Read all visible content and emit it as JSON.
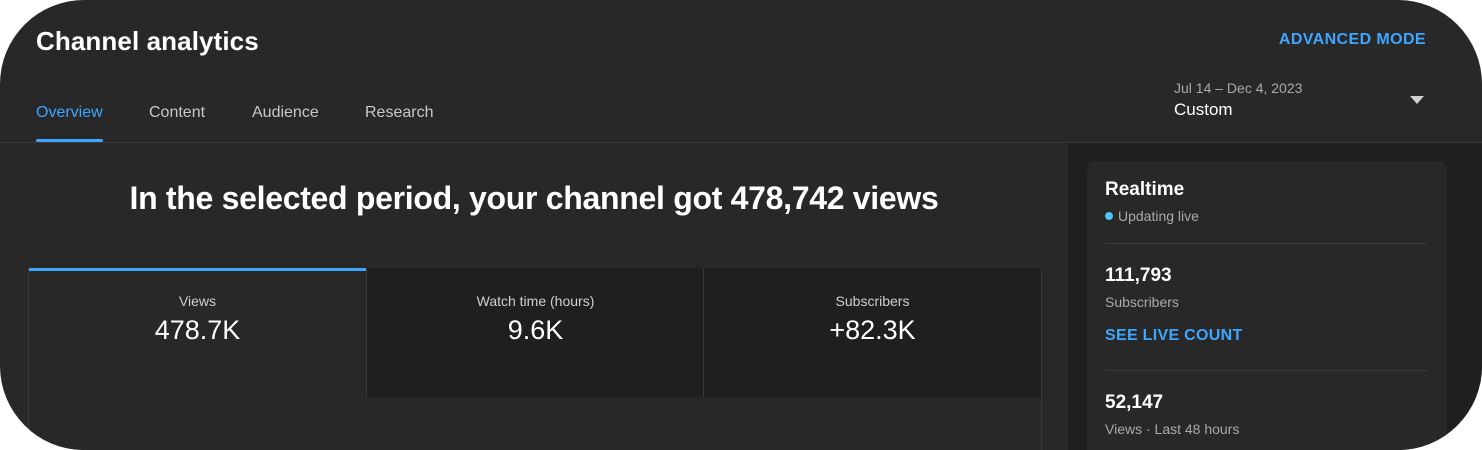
{
  "header": {
    "title": "Channel analytics",
    "advanced_mode_label": "ADVANCED MODE"
  },
  "tabs": [
    {
      "label": "Overview",
      "active": true
    },
    {
      "label": "Content",
      "active": false
    },
    {
      "label": "Audience",
      "active": false
    },
    {
      "label": "Research",
      "active": false
    }
  ],
  "date_picker": {
    "range": "Jul 14 – Dec 4, 2023",
    "preset": "Custom",
    "icon": "chevron-down-icon"
  },
  "summary": {
    "headline": "In the selected period, your channel got 478,742 views"
  },
  "metrics": [
    {
      "label": "Views",
      "value": "478.7K",
      "selected": true
    },
    {
      "label": "Watch time (hours)",
      "value": "9.6K",
      "selected": false
    },
    {
      "label": "Subscribers",
      "value": "+82.3K",
      "selected": false
    }
  ],
  "realtime": {
    "title": "Realtime",
    "status": "Updating live",
    "subscribers_count": "111,793",
    "subscribers_label": "Subscribers",
    "see_live_count_label": "SEE LIVE COUNT",
    "views_count": "52,147",
    "views_label": "Views · Last 48 hours"
  },
  "colors": {
    "background": "#282828",
    "accent": "#3ea6ff",
    "live_dot": "#4fc3f7"
  }
}
